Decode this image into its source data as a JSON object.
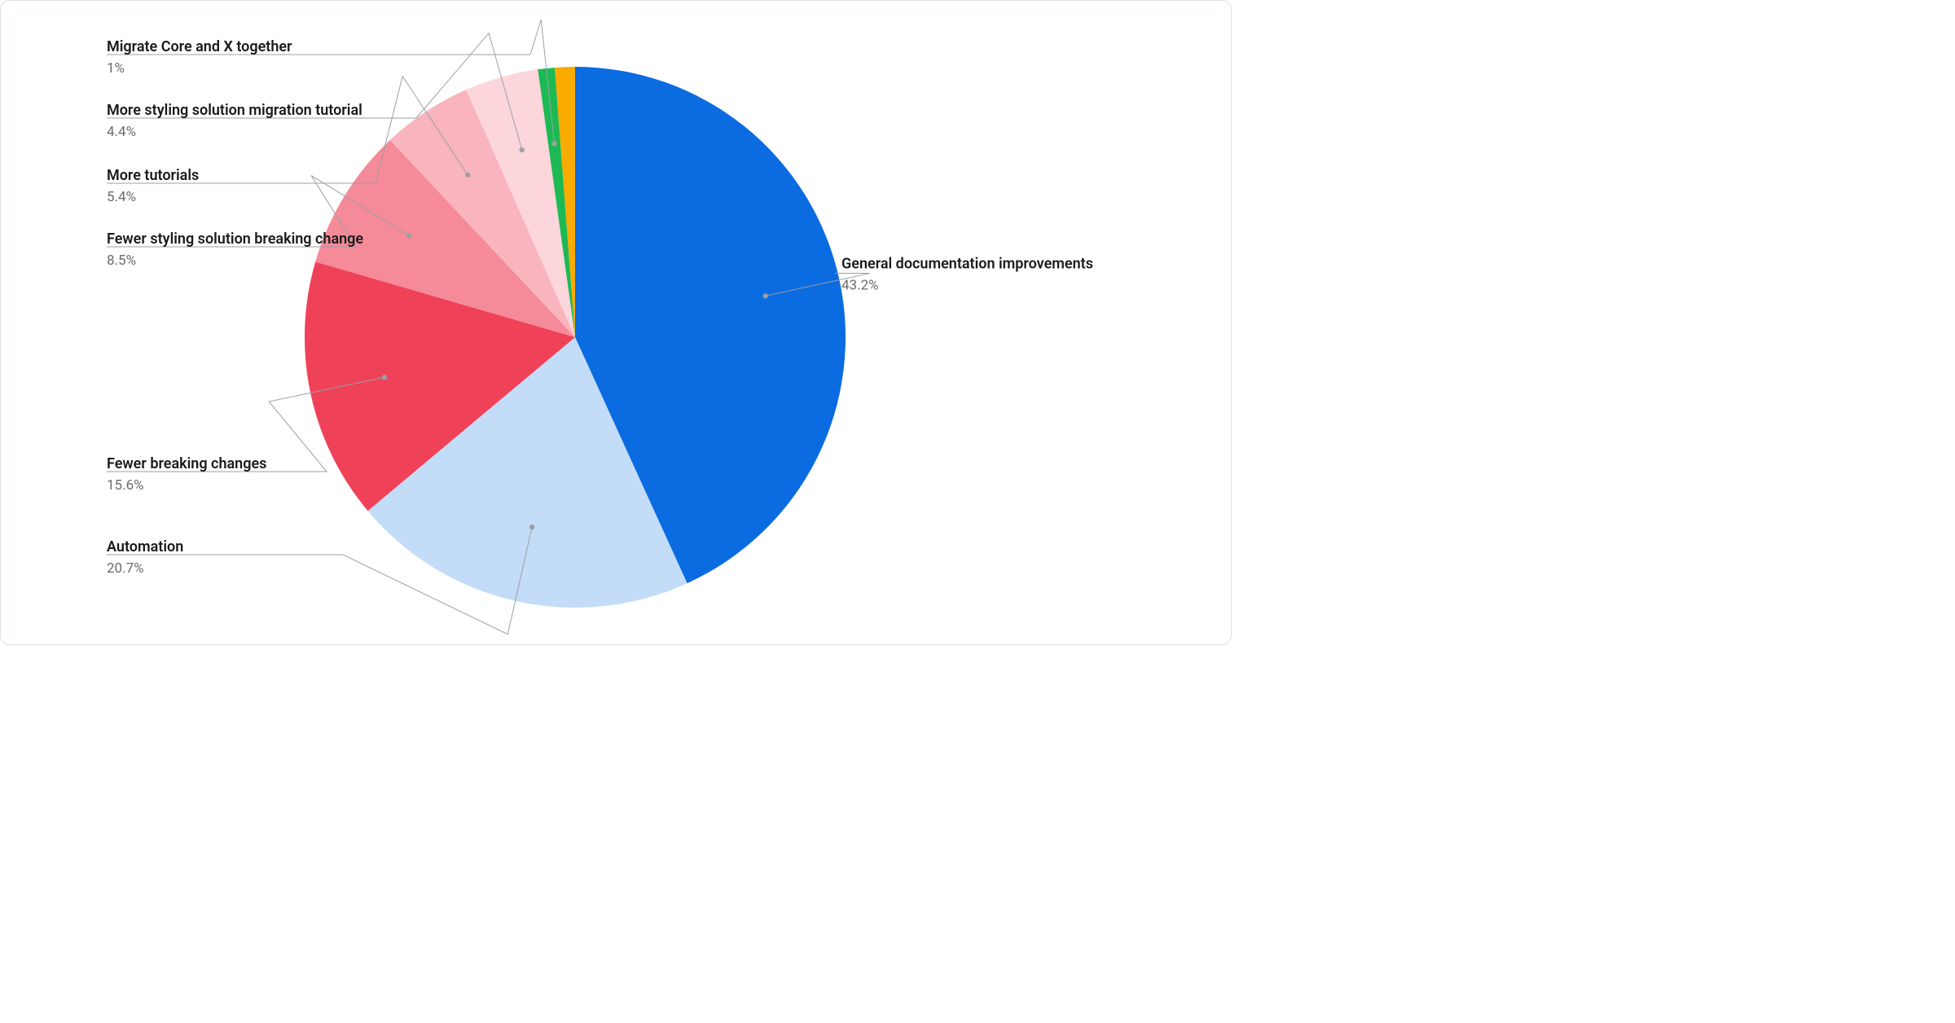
{
  "chart_data": {
    "type": "pie",
    "slices": [
      {
        "name": "General documentation improvements",
        "value": 43.2,
        "pct_label": "43.2%",
        "color": "#0b6be0"
      },
      {
        "name": "Automation",
        "value": 20.7,
        "pct_label": "20.7%",
        "color": "#c3dcf7"
      },
      {
        "name": "Fewer breaking changes",
        "value": 15.6,
        "pct_label": "15.6%",
        "color": "#ef4258"
      },
      {
        "name": "Fewer styling solution breaking change",
        "value": 8.5,
        "pct_label": "8.5%",
        "color": "#f58a98"
      },
      {
        "name": "More tutorials",
        "value": 5.4,
        "pct_label": "5.4%",
        "color": "#f9b4bd"
      },
      {
        "name": "More styling solution migration tutorial",
        "value": 4.4,
        "pct_label": "4.4%",
        "color": "#fcd6db"
      },
      {
        "name": "Migrate Core and X together",
        "value": 1.0,
        "pct_label": "1%",
        "color": "#1db954"
      },
      {
        "name": "",
        "value": 1.2,
        "pct_label": "",
        "color": "#f9ab00"
      }
    ]
  }
}
